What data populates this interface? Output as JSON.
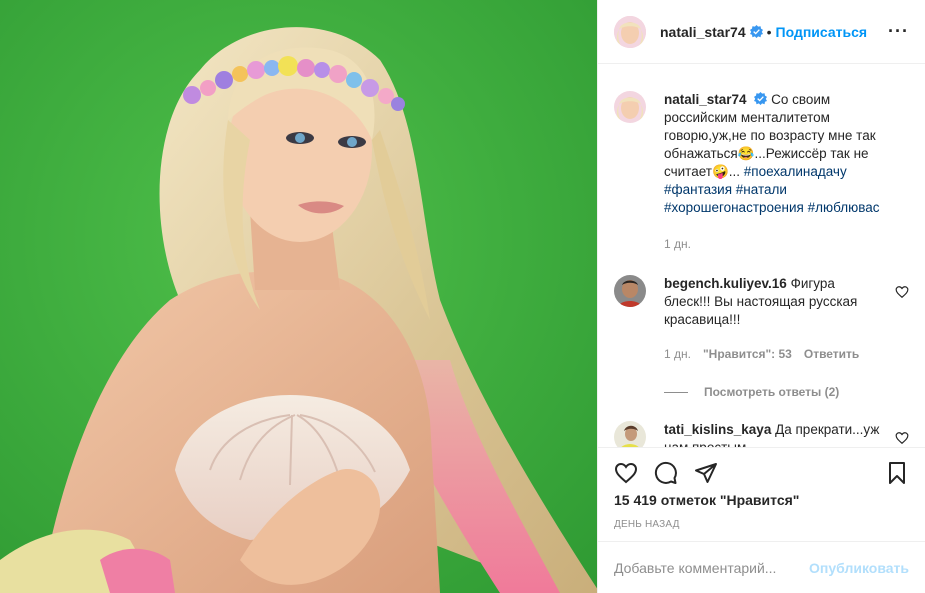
{
  "photo": {
    "alt_icon": "post-photo",
    "background": "#3fae3f"
  },
  "header": {
    "username": "natali_star74",
    "dot": "•",
    "follow_label": "Подписаться",
    "more_label": "···"
  },
  "caption": {
    "username": "natali_star74",
    "text_1": "Со своим российским менталитетом говорю,уж,не по возрасту мне так обнажаться😂...Режиссёр так не считает🤪...",
    "hashtags": [
      "#поехалинадачу",
      "#фантазия",
      "#натали",
      "#хорошегонастроения",
      "#люблювас"
    ],
    "time": "1 дн."
  },
  "comments": [
    {
      "username": "begench.kuliyev.16",
      "text": "Фигура блеск!!! Вы настоящая русская красавица!!!",
      "time": "1 дн.",
      "likes": "\"Нравится\": 53",
      "reply_label": "Ответить",
      "view_replies": "Посмотреть ответы (2)"
    },
    {
      "username": "tati_kislins_kaya",
      "text": "Да прекрати...уж нам простым"
    }
  ],
  "actions": {
    "likes_text": "15 419 отметок \"Нравится\"",
    "date_text": "день назад"
  },
  "add_comment": {
    "placeholder": "Добавьте комментарий...",
    "publish_label": "Опубликовать"
  },
  "colors": {
    "accent": "#0095f6",
    "hashtag": "#00376b",
    "muted": "#8e8e8e",
    "publish_disabled": "#b2dffc"
  }
}
